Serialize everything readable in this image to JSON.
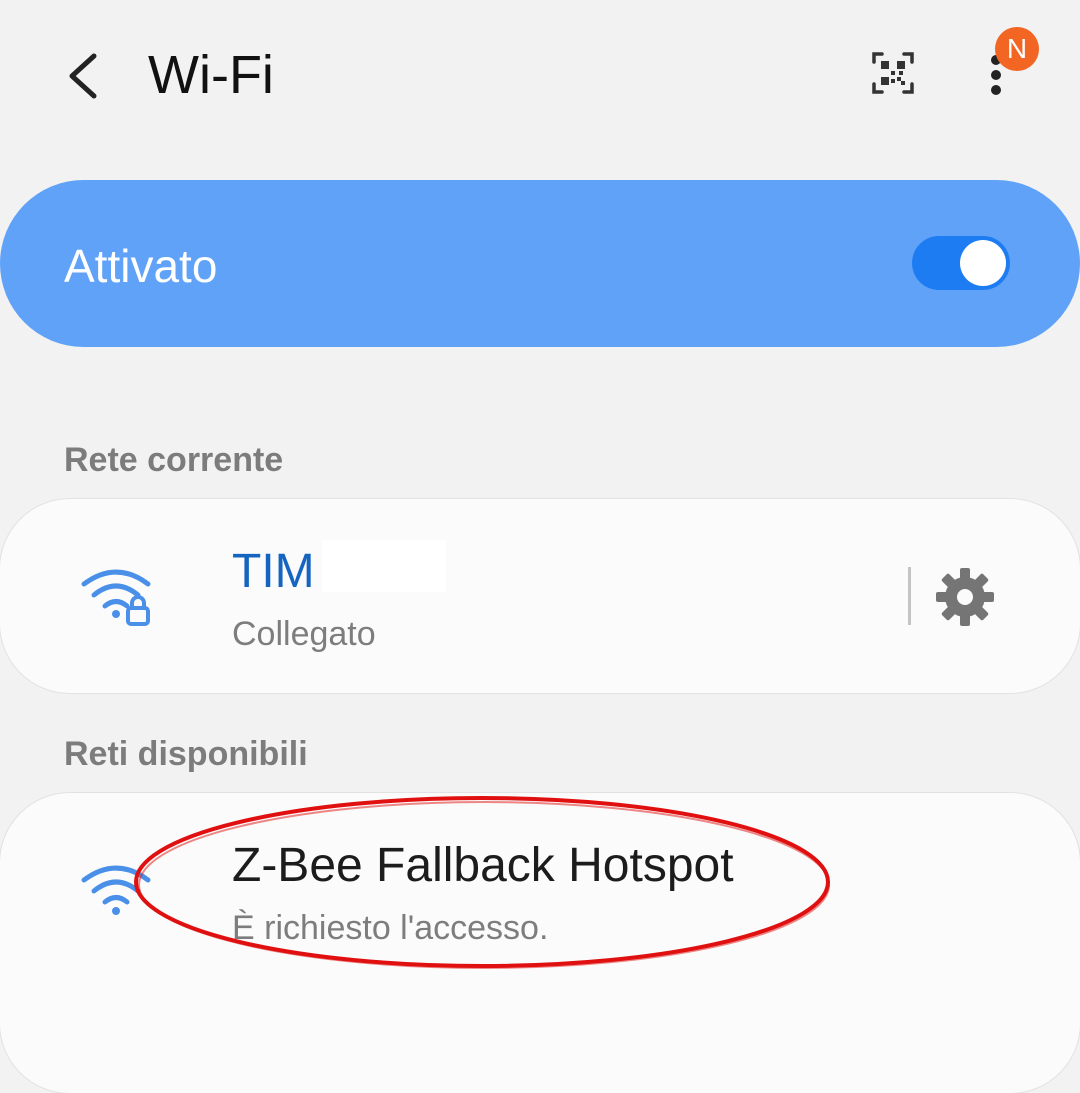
{
  "header": {
    "title": "Wi-Fi",
    "back_icon": "back-arrow-icon",
    "qr_icon": "qr-scan-icon",
    "more_icon": "more-vertical-icon",
    "notification_badge": "N",
    "badge_color": "#f26522"
  },
  "master_toggle": {
    "label": "Attivato",
    "state": "on",
    "card_color": "#5fa2f8",
    "switch_color": "#1e7cf3"
  },
  "current_network": {
    "section_label": "Rete corrente",
    "name": "TIM",
    "status": "Collegato",
    "signal_icon": "wifi-locked-icon",
    "settings_icon": "gear-icon",
    "name_color": "#1565c0"
  },
  "available_networks": {
    "section_label": "Reti disponibili",
    "items": [
      {
        "name": "Z-Bee Fallback Hotspot",
        "status": "È richiesto l'accesso.",
        "signal_icon": "wifi-icon"
      }
    ]
  },
  "annotation": {
    "shape": "ellipse",
    "color": "#e01010"
  }
}
